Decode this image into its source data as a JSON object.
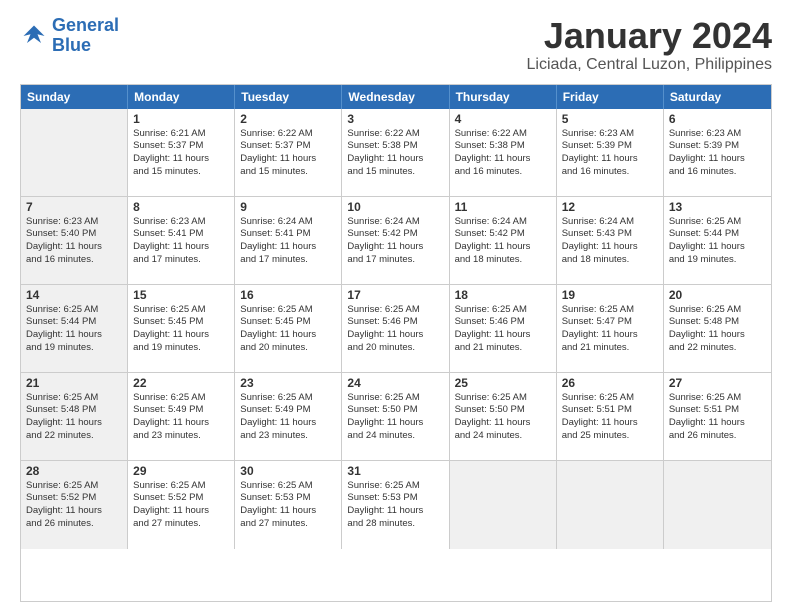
{
  "logo": {
    "line1": "General",
    "line2": "Blue"
  },
  "title": "January 2024",
  "subtitle": "Liciada, Central Luzon, Philippines",
  "header_days": [
    "Sunday",
    "Monday",
    "Tuesday",
    "Wednesday",
    "Thursday",
    "Friday",
    "Saturday"
  ],
  "weeks": [
    [
      {
        "day": "",
        "info": "",
        "shaded": true
      },
      {
        "day": "1",
        "info": "Sunrise: 6:21 AM\nSunset: 5:37 PM\nDaylight: 11 hours\nand 15 minutes.",
        "shaded": false
      },
      {
        "day": "2",
        "info": "Sunrise: 6:22 AM\nSunset: 5:37 PM\nDaylight: 11 hours\nand 15 minutes.",
        "shaded": false
      },
      {
        "day": "3",
        "info": "Sunrise: 6:22 AM\nSunset: 5:38 PM\nDaylight: 11 hours\nand 15 minutes.",
        "shaded": false
      },
      {
        "day": "4",
        "info": "Sunrise: 6:22 AM\nSunset: 5:38 PM\nDaylight: 11 hours\nand 16 minutes.",
        "shaded": false
      },
      {
        "day": "5",
        "info": "Sunrise: 6:23 AM\nSunset: 5:39 PM\nDaylight: 11 hours\nand 16 minutes.",
        "shaded": false
      },
      {
        "day": "6",
        "info": "Sunrise: 6:23 AM\nSunset: 5:39 PM\nDaylight: 11 hours\nand 16 minutes.",
        "shaded": false
      }
    ],
    [
      {
        "day": "7",
        "info": "Sunrise: 6:23 AM\nSunset: 5:40 PM\nDaylight: 11 hours\nand 16 minutes.",
        "shaded": true
      },
      {
        "day": "8",
        "info": "Sunrise: 6:23 AM\nSunset: 5:41 PM\nDaylight: 11 hours\nand 17 minutes.",
        "shaded": false
      },
      {
        "day": "9",
        "info": "Sunrise: 6:24 AM\nSunset: 5:41 PM\nDaylight: 11 hours\nand 17 minutes.",
        "shaded": false
      },
      {
        "day": "10",
        "info": "Sunrise: 6:24 AM\nSunset: 5:42 PM\nDaylight: 11 hours\nand 17 minutes.",
        "shaded": false
      },
      {
        "day": "11",
        "info": "Sunrise: 6:24 AM\nSunset: 5:42 PM\nDaylight: 11 hours\nand 18 minutes.",
        "shaded": false
      },
      {
        "day": "12",
        "info": "Sunrise: 6:24 AM\nSunset: 5:43 PM\nDaylight: 11 hours\nand 18 minutes.",
        "shaded": false
      },
      {
        "day": "13",
        "info": "Sunrise: 6:25 AM\nSunset: 5:44 PM\nDaylight: 11 hours\nand 19 minutes.",
        "shaded": false
      }
    ],
    [
      {
        "day": "14",
        "info": "Sunrise: 6:25 AM\nSunset: 5:44 PM\nDaylight: 11 hours\nand 19 minutes.",
        "shaded": true
      },
      {
        "day": "15",
        "info": "Sunrise: 6:25 AM\nSunset: 5:45 PM\nDaylight: 11 hours\nand 19 minutes.",
        "shaded": false
      },
      {
        "day": "16",
        "info": "Sunrise: 6:25 AM\nSunset: 5:45 PM\nDaylight: 11 hours\nand 20 minutes.",
        "shaded": false
      },
      {
        "day": "17",
        "info": "Sunrise: 6:25 AM\nSunset: 5:46 PM\nDaylight: 11 hours\nand 20 minutes.",
        "shaded": false
      },
      {
        "day": "18",
        "info": "Sunrise: 6:25 AM\nSunset: 5:46 PM\nDaylight: 11 hours\nand 21 minutes.",
        "shaded": false
      },
      {
        "day": "19",
        "info": "Sunrise: 6:25 AM\nSunset: 5:47 PM\nDaylight: 11 hours\nand 21 minutes.",
        "shaded": false
      },
      {
        "day": "20",
        "info": "Sunrise: 6:25 AM\nSunset: 5:48 PM\nDaylight: 11 hours\nand 22 minutes.",
        "shaded": false
      }
    ],
    [
      {
        "day": "21",
        "info": "Sunrise: 6:25 AM\nSunset: 5:48 PM\nDaylight: 11 hours\nand 22 minutes.",
        "shaded": true
      },
      {
        "day": "22",
        "info": "Sunrise: 6:25 AM\nSunset: 5:49 PM\nDaylight: 11 hours\nand 23 minutes.",
        "shaded": false
      },
      {
        "day": "23",
        "info": "Sunrise: 6:25 AM\nSunset: 5:49 PM\nDaylight: 11 hours\nand 23 minutes.",
        "shaded": false
      },
      {
        "day": "24",
        "info": "Sunrise: 6:25 AM\nSunset: 5:50 PM\nDaylight: 11 hours\nand 24 minutes.",
        "shaded": false
      },
      {
        "day": "25",
        "info": "Sunrise: 6:25 AM\nSunset: 5:50 PM\nDaylight: 11 hours\nand 24 minutes.",
        "shaded": false
      },
      {
        "day": "26",
        "info": "Sunrise: 6:25 AM\nSunset: 5:51 PM\nDaylight: 11 hours\nand 25 minutes.",
        "shaded": false
      },
      {
        "day": "27",
        "info": "Sunrise: 6:25 AM\nSunset: 5:51 PM\nDaylight: 11 hours\nand 26 minutes.",
        "shaded": false
      }
    ],
    [
      {
        "day": "28",
        "info": "Sunrise: 6:25 AM\nSunset: 5:52 PM\nDaylight: 11 hours\nand 26 minutes.",
        "shaded": true
      },
      {
        "day": "29",
        "info": "Sunrise: 6:25 AM\nSunset: 5:52 PM\nDaylight: 11 hours\nand 27 minutes.",
        "shaded": false
      },
      {
        "day": "30",
        "info": "Sunrise: 6:25 AM\nSunset: 5:53 PM\nDaylight: 11 hours\nand 27 minutes.",
        "shaded": false
      },
      {
        "day": "31",
        "info": "Sunrise: 6:25 AM\nSunset: 5:53 PM\nDaylight: 11 hours\nand 28 minutes.",
        "shaded": false
      },
      {
        "day": "",
        "info": "",
        "shaded": true
      },
      {
        "day": "",
        "info": "",
        "shaded": true
      },
      {
        "day": "",
        "info": "",
        "shaded": true
      }
    ]
  ]
}
